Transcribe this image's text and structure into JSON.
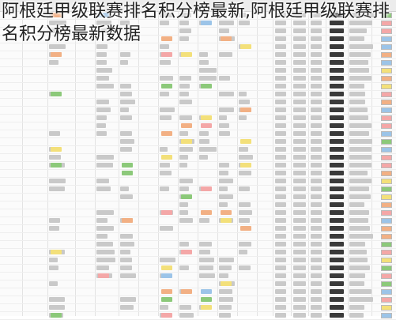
{
  "caption": "阿根廷甲级联赛排名积分榜最新,阿根廷甲级联赛排名积分榜最新数据",
  "colors": {
    "green": "#8cc97a",
    "orange": "#f2b084",
    "yellow": "#f3e07a",
    "pink": "#f4a7a7",
    "blue": "#9cc4e8"
  }
}
